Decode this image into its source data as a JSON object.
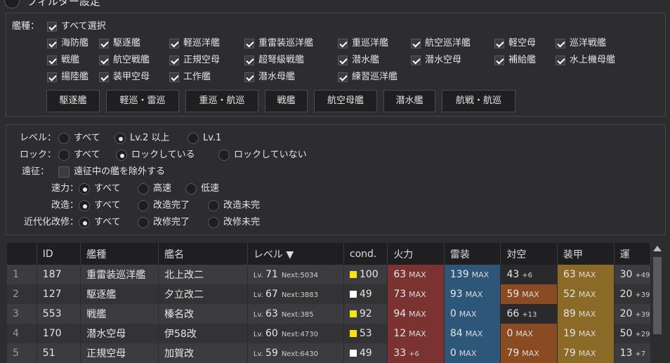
{
  "header": {
    "title": "フィルター設定"
  },
  "ship_type": {
    "label": "艦種：",
    "select_all": "すべて選択",
    "row1": [
      "海防艦",
      "駆逐艦",
      "軽巡洋艦",
      "重雷装巡洋艦",
      "重巡洋艦",
      "航空巡洋艦",
      "軽空母",
      "巡洋戦艦"
    ],
    "row2": [
      "戦艦",
      "航空戦艦",
      "正規空母",
      "超弩級戦艦",
      "潜水艦",
      "潜水空母",
      "補給艦",
      "水上機母艦"
    ],
    "row3": [
      "揚陸艦",
      "装甲空母",
      "工作艦",
      "潜水母艦",
      "練習巡洋艦"
    ],
    "buttons": [
      "駆逐艦",
      "軽巡・雷巡",
      "重巡・航巡",
      "戦艦",
      "航空母艦",
      "潜水艦",
      "航戦・航巡"
    ]
  },
  "filters": {
    "level": {
      "label": "レベル：",
      "options": [
        "すべて",
        "Lv.2 以上",
        "Lv.1"
      ],
      "selected": 1
    },
    "lock": {
      "label": "ロック：",
      "options": [
        "すべて",
        "ロックしている",
        "ロックしていない"
      ],
      "selected": 1
    },
    "expedition": {
      "label": "遠征：",
      "text": "遠征中の艦を除外する"
    },
    "speed": {
      "label": "速力：",
      "options": [
        "すべて",
        "高速",
        "低速"
      ],
      "selected": 0
    },
    "remodel": {
      "label": "改造：",
      "options": [
        "すべて",
        "改造完了",
        "改造未完"
      ],
      "selected": 0
    },
    "modernize": {
      "label": "近代化改修：",
      "options": [
        "すべて",
        "改修完了",
        "改修未完"
      ],
      "selected": 0
    }
  },
  "table": {
    "headers": [
      "",
      "ID",
      "艦種",
      "艦名",
      "レベル ▼",
      "cond.",
      "火力",
      "雷装",
      "対空",
      "装甲",
      "運"
    ],
    "rows": [
      {
        "n": "1",
        "id": "187",
        "type": "重雷装巡洋艦",
        "name": "北上改二",
        "lv": "71",
        "next": "Next:5034",
        "cond": "100",
        "condc": "#f2e31b",
        "fp": "63",
        "fpm": "MAX",
        "tp": "139",
        "tpm": "MAX",
        "aa": "43",
        "aab": "+6",
        "ar": "63",
        "arm": "MAX",
        "lk": "30",
        "lkb": "+49"
      },
      {
        "n": "2",
        "id": "127",
        "type": "駆逐艦",
        "name": "夕立改二",
        "lv": "67",
        "next": "Next:3883",
        "cond": "49",
        "condc": "#ffffff",
        "fp": "73",
        "fpm": "MAX",
        "tp": "93",
        "tpm": "MAX",
        "aa": "59",
        "aab": "MAX",
        "ar": "52",
        "arm": "MAX",
        "lk": "20",
        "lkb": "+39"
      },
      {
        "n": "3",
        "id": "553",
        "type": "戦艦",
        "name": "榛名改",
        "lv": "63",
        "next": "Next:385",
        "cond": "92",
        "condc": "#f2e31b",
        "fp": "94",
        "fpm": "MAX",
        "tp": "0",
        "tpm": "MAX",
        "aa": "66",
        "aab": "+13",
        "ar": "89",
        "arm": "MAX",
        "lk": "20",
        "lkb": "+39"
      },
      {
        "n": "4",
        "id": "170",
        "type": "潜水空母",
        "name": "伊58改",
        "lv": "60",
        "next": "Next:4730",
        "cond": "53",
        "condc": "#f2e31b",
        "fp": "12",
        "fpm": "MAX",
        "tp": "84",
        "tpm": "MAX",
        "aa": "0",
        "aab": "MAX",
        "ar": "19",
        "arm": "MAX",
        "lk": "50",
        "lkb": "+29"
      },
      {
        "n": "5",
        "id": "51",
        "type": "正規空母",
        "name": "加賀改",
        "lv": "59",
        "next": "Next:6430",
        "cond": "49",
        "condc": "#ffffff",
        "fp": "33",
        "fpm": "+6",
        "tp": "0",
        "tpm": "MAX",
        "aa": "79",
        "aab": "MAX",
        "ar": "79",
        "arm": "MAX",
        "lk": "13",
        "lkb": "+7"
      }
    ]
  },
  "colors": {
    "fp_bg": "#7a3330",
    "tp_bg": "#2d5678",
    "aa_bg": "#8a4a22",
    "ar_bg": "#8a6a26",
    "aa_plain": "#2a2a2c"
  }
}
